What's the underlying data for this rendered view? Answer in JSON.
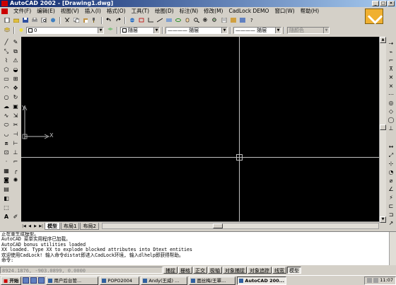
{
  "window": {
    "title": "AutoCAD 2002 - [Drawing1.dwg]",
    "controls": [
      "_",
      "□",
      "×"
    ]
  },
  "menubar": {
    "items": [
      "文件(F)",
      "编辑(E)",
      "视图(V)",
      "插入(I)",
      "格式(O)",
      "工具(T)",
      "绘图(D)",
      "标注(N)",
      "修改(M)",
      "CadLock DEMO",
      "窗口(W)",
      "帮助(H)"
    ]
  },
  "logo": {
    "name": "cadlock-logo",
    "color": "#f0b030"
  },
  "properties_toolbar": {
    "layer_combo": "0",
    "color_combo": "随层",
    "linetype_combo": "———— 随层",
    "lineweight_combo": "———— 随层",
    "plotstyle_combo": "随颜色"
  },
  "canvas": {
    "background": "#000000",
    "crosshair_color": "#c0c0c0",
    "ucs": {
      "x_label": "X",
      "y_label": "Y"
    }
  },
  "layout_tabs": [
    {
      "label": "模型",
      "active": true
    },
    {
      "label": "布局1",
      "active": false
    },
    {
      "label": "布局2",
      "active": false
    }
  ],
  "command_window": {
    "lines": [
      "正在重生成模型。",
      "AutoCAD 菜单实用程序已加载。",
      "AutoCAD bonus utilities loaded",
      "XX loaded. Type XX to explode blocked attributes into Dtext entities",
      "欢迎使用CadLock! 输入命令distat即进入CadLock环境, 输入dlhelp即获得帮助。",
      "命令:"
    ]
  },
  "statusbar": {
    "coords": "8924.1876, -903.0899, 0.0000",
    "modes": [
      {
        "label": "捕捉",
        "on": false
      },
      {
        "label": "栅格",
        "on": false
      },
      {
        "label": "正交",
        "on": false
      },
      {
        "label": "极轴",
        "on": false
      },
      {
        "label": "对象捕捉",
        "on": false
      },
      {
        "label": "对象追踪",
        "on": false
      },
      {
        "label": "线宽",
        "on": false
      },
      {
        "label": "模型",
        "on": true
      }
    ]
  },
  "taskbar": {
    "start_label": "开始",
    "tasks": [
      {
        "label": "用户后台管...",
        "active": false
      },
      {
        "label": "POPO2004",
        "active": false
      },
      {
        "label": "Andy(王威) ...",
        "active": false
      },
      {
        "label": "面丝梅/王單...",
        "active": false
      },
      {
        "label": "AutoCAD 200...",
        "active": true
      }
    ],
    "clock": "11:07"
  }
}
